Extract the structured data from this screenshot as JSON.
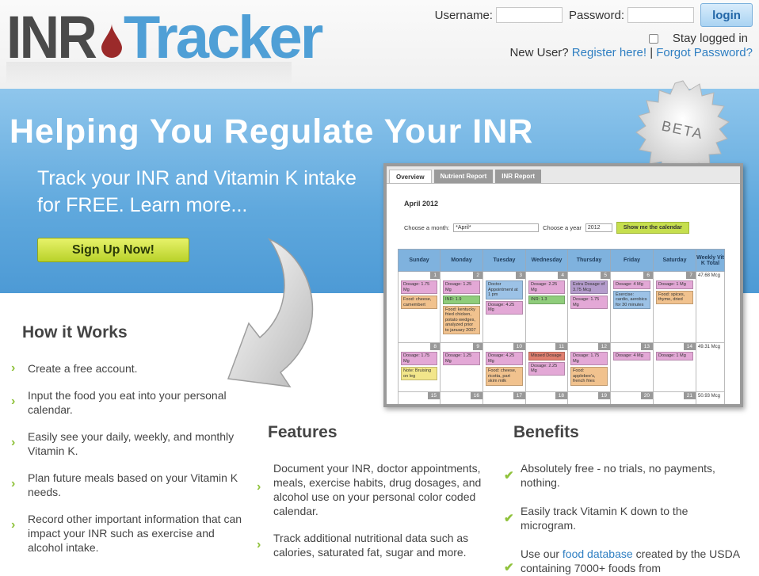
{
  "header": {
    "logo_part1": "INR",
    "logo_part2": "Tracker",
    "username_label": "Username:",
    "password_label": "Password:",
    "login_label": "login",
    "stay_logged_in": "Stay logged in",
    "new_user": "New User?",
    "register_link": "Register here!",
    "separator": "|",
    "forgot_link": "Forgot Password?"
  },
  "banner": {
    "headline": "Helping You Regulate Your INR",
    "subheadline": "Track your INR and Vitamin K intake for FREE. Learn more...",
    "signup_label": "Sign Up Now!",
    "beta_badge": "BETA"
  },
  "preview": {
    "tabs": [
      "Overview",
      "Nutrient Report",
      "INR Report"
    ],
    "month_title": "April 2012",
    "choose_month_label": "Choose a month:",
    "month_value": "*April*",
    "choose_year_label": "Choose a year",
    "year_value": "2012",
    "show_button": "Show me the calendar",
    "days": [
      "Sunday",
      "Monday",
      "Tuesday",
      "Wednesday",
      "Thursday",
      "Friday",
      "Saturday",
      "Weekly Vit K Total"
    ],
    "weeks": [
      {
        "days": [
          {
            "num": "1",
            "events": [
              {
                "text": "Dosage: 1.75 Mg",
                "color": "pink"
              },
              {
                "text": "Food: cheese, camembert",
                "color": "orange"
              }
            ]
          },
          {
            "num": "2",
            "events": [
              {
                "text": "Dosage: 1.25 Mg",
                "color": "pink"
              },
              {
                "text": "INR: 1.9",
                "color": "green"
              },
              {
                "text": "Food: kentucky fried chicken, potato wedges, analyzed prior to january 2007",
                "color": "orange"
              }
            ]
          },
          {
            "num": "3",
            "events": [
              {
                "text": "Doctor Appointment at 1 pm",
                "color": "blue"
              },
              {
                "text": "Dosage: 4.25 Mg",
                "color": "pink"
              }
            ]
          },
          {
            "num": "4",
            "events": [
              {
                "text": "Dosage: 2.25 Mg",
                "color": "pink"
              },
              {
                "text": "INR: 1.3",
                "color": "green"
              }
            ]
          },
          {
            "num": "5",
            "events": [
              {
                "text": "Extra Dosage of 3.75 Mcg",
                "color": "purple"
              },
              {
                "text": "Dosage: 1.75 Mg",
                "color": "pink"
              }
            ]
          },
          {
            "num": "6",
            "events": [
              {
                "text": "Dosage: 4 Mg",
                "color": "pink"
              },
              {
                "text": "Exercise: cardio, aerobics for 30 minutes",
                "color": "blue"
              }
            ]
          },
          {
            "num": "7",
            "events": [
              {
                "text": "Dosage: 1 Mg",
                "color": "pink"
              },
              {
                "text": "Food: spices, thyme, dried",
                "color": "orange"
              }
            ]
          }
        ],
        "total": "47.68 Mcg"
      },
      {
        "days": [
          {
            "num": "8",
            "events": [
              {
                "text": "Dosage: 1.75 Mg",
                "color": "pink"
              },
              {
                "text": "Note: Bruising on leg",
                "color": "yellow"
              }
            ]
          },
          {
            "num": "9",
            "events": [
              {
                "text": "Dosage: 1.25 Mg",
                "color": "pink"
              }
            ]
          },
          {
            "num": "10",
            "events": [
              {
                "text": "Dosage: 4.25 Mg",
                "color": "pink"
              },
              {
                "text": "Food: cheese, ricotta, part skim milk",
                "color": "orange"
              }
            ]
          },
          {
            "num": "11",
            "events": [
              {
                "text": "Missed Dosage",
                "color": "red"
              },
              {
                "text": "Dosage: 2.25 Mg",
                "color": "pink"
              }
            ]
          },
          {
            "num": "12",
            "events": [
              {
                "text": "Dosage: 1.75 Mg",
                "color": "pink"
              },
              {
                "text": "Food: applebee's, french fries",
                "color": "orange"
              }
            ]
          },
          {
            "num": "13",
            "events": [
              {
                "text": "Dosage: 4 Mg",
                "color": "pink"
              }
            ]
          },
          {
            "num": "14",
            "events": [
              {
                "text": "Dosage: 1 Mg",
                "color": "pink"
              }
            ]
          }
        ],
        "total": "49.31 Mcg"
      },
      {
        "days": [
          {
            "num": "15",
            "events": []
          },
          {
            "num": "16",
            "events": []
          },
          {
            "num": "17",
            "events": []
          },
          {
            "num": "18",
            "events": []
          },
          {
            "num": "19",
            "events": []
          },
          {
            "num": "20",
            "events": []
          },
          {
            "num": "21",
            "events": []
          }
        ],
        "total": "50.93 Mcg"
      }
    ]
  },
  "how": {
    "title": "How it Works",
    "items": [
      "Create a free account.",
      "Input the food you eat into your personal calendar.",
      "Easily see your daily, weekly, and monthly Vitamin K.",
      "Plan future meals based on your Vitamin K needs.",
      "Record other important information that can impact your INR such as exercise and alcohol intake."
    ]
  },
  "features": {
    "title": "Features",
    "items": [
      "Document your INR, doctor appointments, meals, exercise habits, drug dosages, and alcohol use on your personal color coded calendar.",
      "Track additional nutritional data such as calories, saturated fat, sugar and more."
    ]
  },
  "benefits": {
    "title": "Benefits",
    "items": [
      "Absolutely free - no trials, no payments, nothing.",
      "Easily track Vitamin K down to the microgram."
    ],
    "last_prefix": "Use our",
    "last_link": "food database",
    "last_suffix": "created by the USDA containing 7000+ foods from"
  },
  "colors": {
    "accent_blue": "#4f9fd6",
    "banner_blue": "#5fa8dd",
    "signup_green": "#c6df4e",
    "link_blue": "#2f7fc2",
    "chevron_green": "#8fc23b"
  }
}
